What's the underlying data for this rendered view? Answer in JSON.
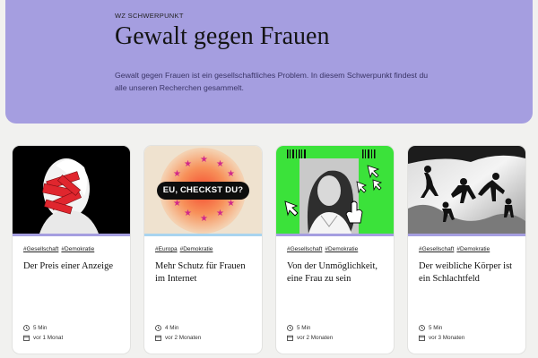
{
  "hero": {
    "kicker": "WZ SCHWERPUNKT",
    "title": "Gewalt gegen Frauen",
    "description": "Gewalt gegen Frauen ist ein gesellschaftliches Problem. In diesem Schwerpunkt findest du alle unseren Recherchen gesammelt.",
    "background_color": "#a59ee0"
  },
  "cards": [
    {
      "tags": [
        "#Gesellschaft",
        "#Demokratie"
      ],
      "title": "Der Preis einer Anzeige",
      "duration": "5 Min",
      "age": "vor 1 Monat",
      "accent": "#a59ee0"
    },
    {
      "tags": [
        "#Europa",
        "#Demokratie"
      ],
      "title": "Mehr Schutz für Frauen im Internet",
      "duration": "4 Min",
      "age": "vor 2 Monaten",
      "accent": "#a8d4ef",
      "image_text": "EU, CHECKST DU?"
    },
    {
      "tags": [
        "#Gesellschaft",
        "#Demokratie"
      ],
      "title": "Von der Unmöglichkeit, eine Frau zu sein",
      "duration": "5 Min",
      "age": "vor 2 Monaten",
      "accent": "#a59ee0"
    },
    {
      "tags": [
        "#Gesellschaft",
        "#Demokratie"
      ],
      "title": "Der weibliche Körper ist ein Schlachtfeld",
      "duration": "5 Min",
      "age": "vor 3 Monaten",
      "accent": "#a59ee0"
    }
  ],
  "icons": {
    "duration": "clock-icon",
    "age": "calendar-icon"
  }
}
